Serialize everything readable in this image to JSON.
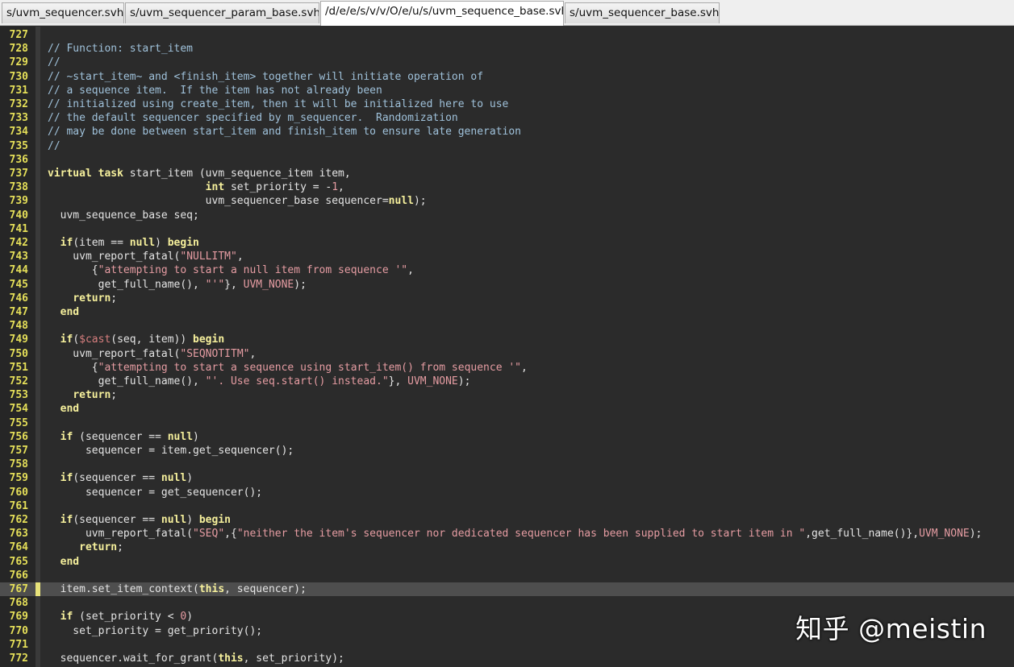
{
  "tabs": [
    {
      "label": "s/uvm_sequencer.svh",
      "active": false
    },
    {
      "label": "s/uvm_sequencer_param_base.svh",
      "active": false
    },
    {
      "label": "/d/e/e/s/v/v/O/e/u/s/uvm_sequence_base.svh",
      "active": true
    },
    {
      "label": "s/uvm_sequencer_base.svh",
      "active": false
    }
  ],
  "editor": {
    "current_line": 767,
    "lines": [
      {
        "n": "727",
        "t": ""
      },
      {
        "n": "728",
        "t": "// Function: start_item"
      },
      {
        "n": "729",
        "t": "//"
      },
      {
        "n": "730",
        "t": "// ~start_item~ and <finish_item> together will initiate operation of"
      },
      {
        "n": "731",
        "t": "// a sequence item.  If the item has not already been"
      },
      {
        "n": "732",
        "t": "// initialized using create_item, then it will be initialized here to use"
      },
      {
        "n": "733",
        "t": "// the default sequencer specified by m_sequencer.  Randomization"
      },
      {
        "n": "734",
        "t": "// may be done between start_item and finish_item to ensure late generation"
      },
      {
        "n": "735",
        "t": "//"
      },
      {
        "n": "736",
        "t": ""
      },
      {
        "n": "737",
        "t": "virtual task start_item (uvm_sequence_item item,"
      },
      {
        "n": "738",
        "t": "                         int set_priority = -1,"
      },
      {
        "n": "739",
        "t": "                         uvm_sequencer_base sequencer=null);"
      },
      {
        "n": "740",
        "t": "  uvm_sequence_base seq;"
      },
      {
        "n": "741",
        "t": ""
      },
      {
        "n": "742",
        "t": "  if(item == null) begin"
      },
      {
        "n": "743",
        "t": "    uvm_report_fatal(\"NULLITM\","
      },
      {
        "n": "744",
        "t": "       {\"attempting to start a null item from sequence '\","
      },
      {
        "n": "745",
        "t": "        get_full_name(), \"'\"}, UVM_NONE);"
      },
      {
        "n": "746",
        "t": "    return;"
      },
      {
        "n": "747",
        "t": "  end"
      },
      {
        "n": "748",
        "t": ""
      },
      {
        "n": "749",
        "t": "  if($cast(seq, item)) begin"
      },
      {
        "n": "750",
        "t": "    uvm_report_fatal(\"SEQNOTITM\","
      },
      {
        "n": "751",
        "t": "       {\"attempting to start a sequence using start_item() from sequence '\","
      },
      {
        "n": "752",
        "t": "        get_full_name(), \"'. Use seq.start() instead.\"}, UVM_NONE);"
      },
      {
        "n": "753",
        "t": "    return;"
      },
      {
        "n": "754",
        "t": "  end"
      },
      {
        "n": "755",
        "t": ""
      },
      {
        "n": "756",
        "t": "  if (sequencer == null)"
      },
      {
        "n": "757",
        "t": "      sequencer = item.get_sequencer();"
      },
      {
        "n": "758",
        "t": ""
      },
      {
        "n": "759",
        "t": "  if(sequencer == null)"
      },
      {
        "n": "760",
        "t": "      sequencer = get_sequencer();"
      },
      {
        "n": "761",
        "t": ""
      },
      {
        "n": "762",
        "t": "  if(sequencer == null) begin"
      },
      {
        "n": "763",
        "t": "      uvm_report_fatal(\"SEQ\",{\"neither the item's sequencer nor dedicated sequencer has been supplied to start item in \",get_full_name()},UVM_NONE);"
      },
      {
        "n": "764",
        "t": "     return;"
      },
      {
        "n": "765",
        "t": "  end"
      },
      {
        "n": "766",
        "t": ""
      },
      {
        "n": "767",
        "t": "  item.set_item_context(this, sequencer);"
      },
      {
        "n": "768",
        "t": ""
      },
      {
        "n": "769",
        "t": "  if (set_priority < 0)"
      },
      {
        "n": "770",
        "t": "    set_priority = get_priority();"
      },
      {
        "n": "771",
        "t": ""
      },
      {
        "n": "772",
        "t": "  sequencer.wait_for_grant(this, set_priority);"
      }
    ]
  },
  "watermark": "知乎 @meistin",
  "colors": {
    "background": "#2b2b2b",
    "line_number": "#e5df59",
    "comment": "#9fc1da",
    "keyword": "#f6f09c",
    "string": "#e59ca2",
    "current_line": "#4e4e4e"
  }
}
